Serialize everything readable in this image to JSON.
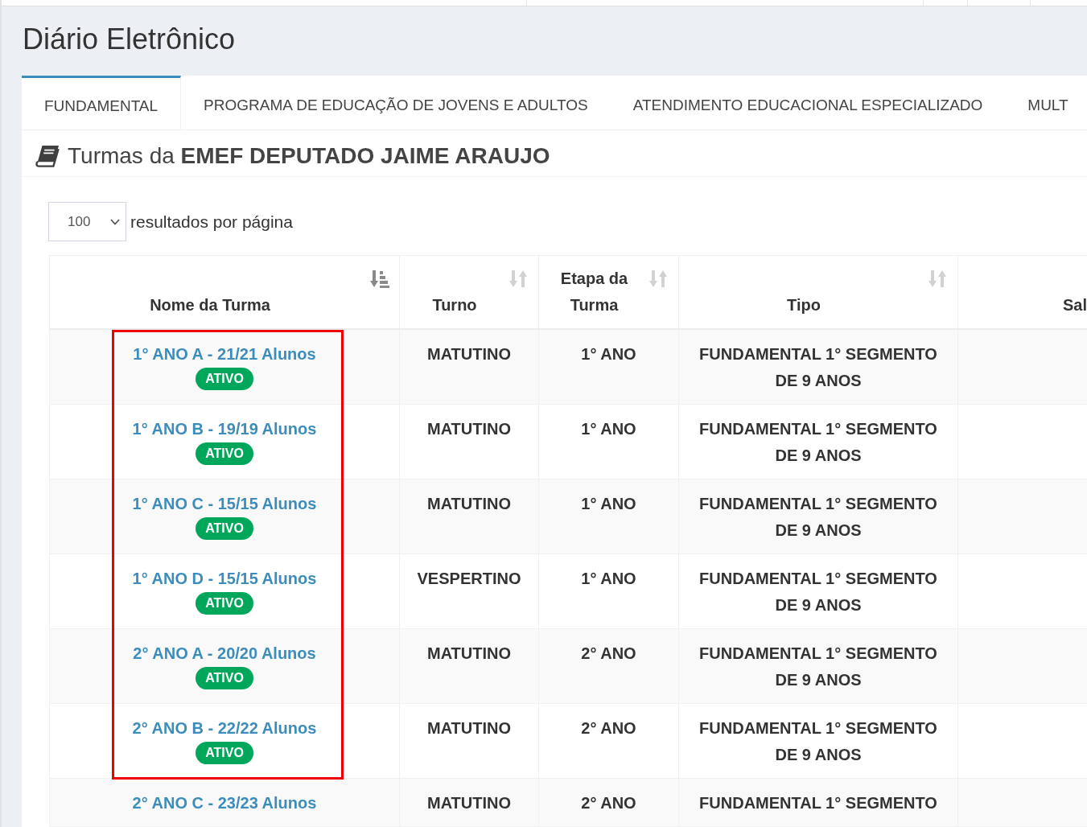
{
  "page": {
    "title": "Diário Eletrônico"
  },
  "tabs": [
    {
      "label": "FUNDAMENTAL",
      "selected": true
    },
    {
      "label": "PROGRAMA DE EDUCAÇÃO DE JOVENS E ADULTOS",
      "selected": false
    },
    {
      "label": "ATENDIMENTO EDUCACIONAL ESPECIALIZADO",
      "selected": false
    },
    {
      "label": "MULT",
      "selected": false
    }
  ],
  "section": {
    "heading": "Turmas da **EMEF DEPUTADO JAIME ARAUJO**"
  },
  "page_size": {
    "value": "100",
    "label": "resultados por página"
  },
  "table": {
    "columns": [
      {
        "label": "Nome da Turma",
        "sorted": true
      },
      {
        "label": "Turno",
        "sorted": false
      },
      {
        "label": "Etapa da Turma",
        "sorted": false
      },
      {
        "label": "Tipo",
        "sorted": false
      },
      {
        "label": "Sal"
      }
    ],
    "rows": [
      {
        "name": "1° ANO A - 21/21 Alunos",
        "status": "ATIVO",
        "shift": "MATUTINO",
        "stage": "1° ANO",
        "type": "FUNDAMENTAL 1° SEGMENTO DE 9 ANOS",
        "highlighted": true
      },
      {
        "name": "1° ANO B - 19/19 Alunos",
        "status": "ATIVO",
        "shift": "MATUTINO",
        "stage": "1° ANO",
        "type": "FUNDAMENTAL 1° SEGMENTO DE 9 ANOS",
        "highlighted": true
      },
      {
        "name": "1° ANO C - 15/15 Alunos",
        "status": "ATIVO",
        "shift": "MATUTINO",
        "stage": "1° ANO",
        "type": "FUNDAMENTAL 1° SEGMENTO DE 9 ANOS",
        "highlighted": true
      },
      {
        "name": "1° ANO D - 15/15 Alunos",
        "status": "ATIVO",
        "shift": "VESPERTINO",
        "stage": "1° ANO",
        "type": "FUNDAMENTAL 1° SEGMENTO DE 9 ANOS",
        "highlighted": true
      },
      {
        "name": "2° ANO A - 20/20 Alunos",
        "status": "ATIVO",
        "shift": "MATUTINO",
        "stage": "2° ANO",
        "type": "FUNDAMENTAL 1° SEGMENTO DE 9 ANOS",
        "highlighted": true
      },
      {
        "name": "2° ANO B - 22/22 Alunos",
        "status": "ATIVO",
        "shift": "MATUTINO",
        "stage": "2° ANO",
        "type": "FUNDAMENTAL 1° SEGMENTO DE 9 ANOS",
        "highlighted": true
      },
      {
        "name": "2° ANO C - 23/23 Alunos",
        "shift": "MATUTINO",
        "stage": "2° ANO",
        "type": "FUNDAMENTAL 1° SEGMENTO",
        "highlighted": false
      }
    ]
  }
}
